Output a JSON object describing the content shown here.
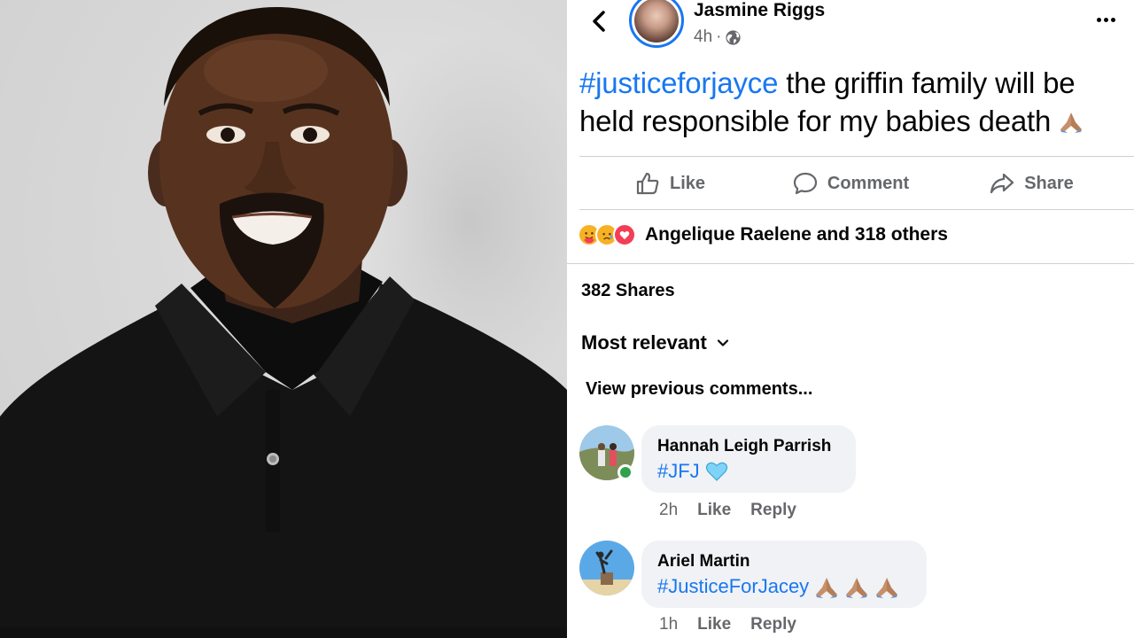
{
  "post": {
    "author": "Jasmine Riggs",
    "time": "4h",
    "separator": "·",
    "hashtag": "#justiceforjayce",
    "text": " the griffin family will be held responsible for my babies death"
  },
  "actions": {
    "like": "Like",
    "comment": "Comment",
    "share": "Share"
  },
  "reactions": {
    "icons": [
      "care-reaction-icon",
      "sad-reaction-icon",
      "love-reaction-icon"
    ],
    "summary": "Angelique Raelene and 318 others"
  },
  "shares": "382 Shares",
  "sort": {
    "label": "Most relevant"
  },
  "view_previous": "View previous comments...",
  "comments": [
    {
      "name": "Hannah Leigh Parrish",
      "text": "#JFJ",
      "emoji": "light-blue-heart-icon",
      "time": "2h",
      "like": "Like",
      "reply": "Reply",
      "online": true
    },
    {
      "name": "Ariel Martin",
      "text": "#JusticeForJacey",
      "emoji": "praying-hands-icon",
      "time": "1h",
      "like": "Like",
      "reply": "Reply",
      "online": false
    }
  ],
  "colors": {
    "link_blue": "#1877f2",
    "secondary_text": "#65676b",
    "bubble_bg": "#f0f2f5",
    "divider": "#ced0d4",
    "online_green": "#31a24c"
  }
}
